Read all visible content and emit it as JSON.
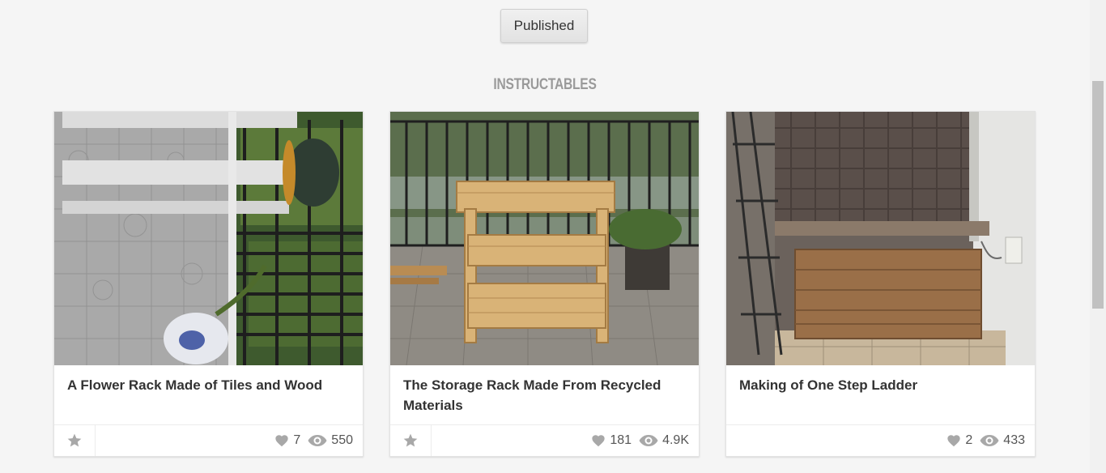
{
  "published_button": "Published",
  "section_title": "INSTRUCTABLES",
  "cards": [
    {
      "title": "A Flower Rack Made of Tiles and Wood",
      "favorites": "7",
      "views": "550"
    },
    {
      "title": "The Storage Rack Made From Recycled Materials",
      "favorites": "181",
      "views": "4.9K"
    },
    {
      "title": "Making of One Step Ladder",
      "favorites": "2",
      "views": "433"
    }
  ],
  "icons": {
    "favorite": "star-icon",
    "likes": "heart-icon",
    "views": "eye-icon"
  },
  "colors": {
    "background": "#f5f5f5",
    "title_text": "#333333",
    "section_title": "#9a9a9a",
    "icon_gray": "#a8a8a8"
  }
}
